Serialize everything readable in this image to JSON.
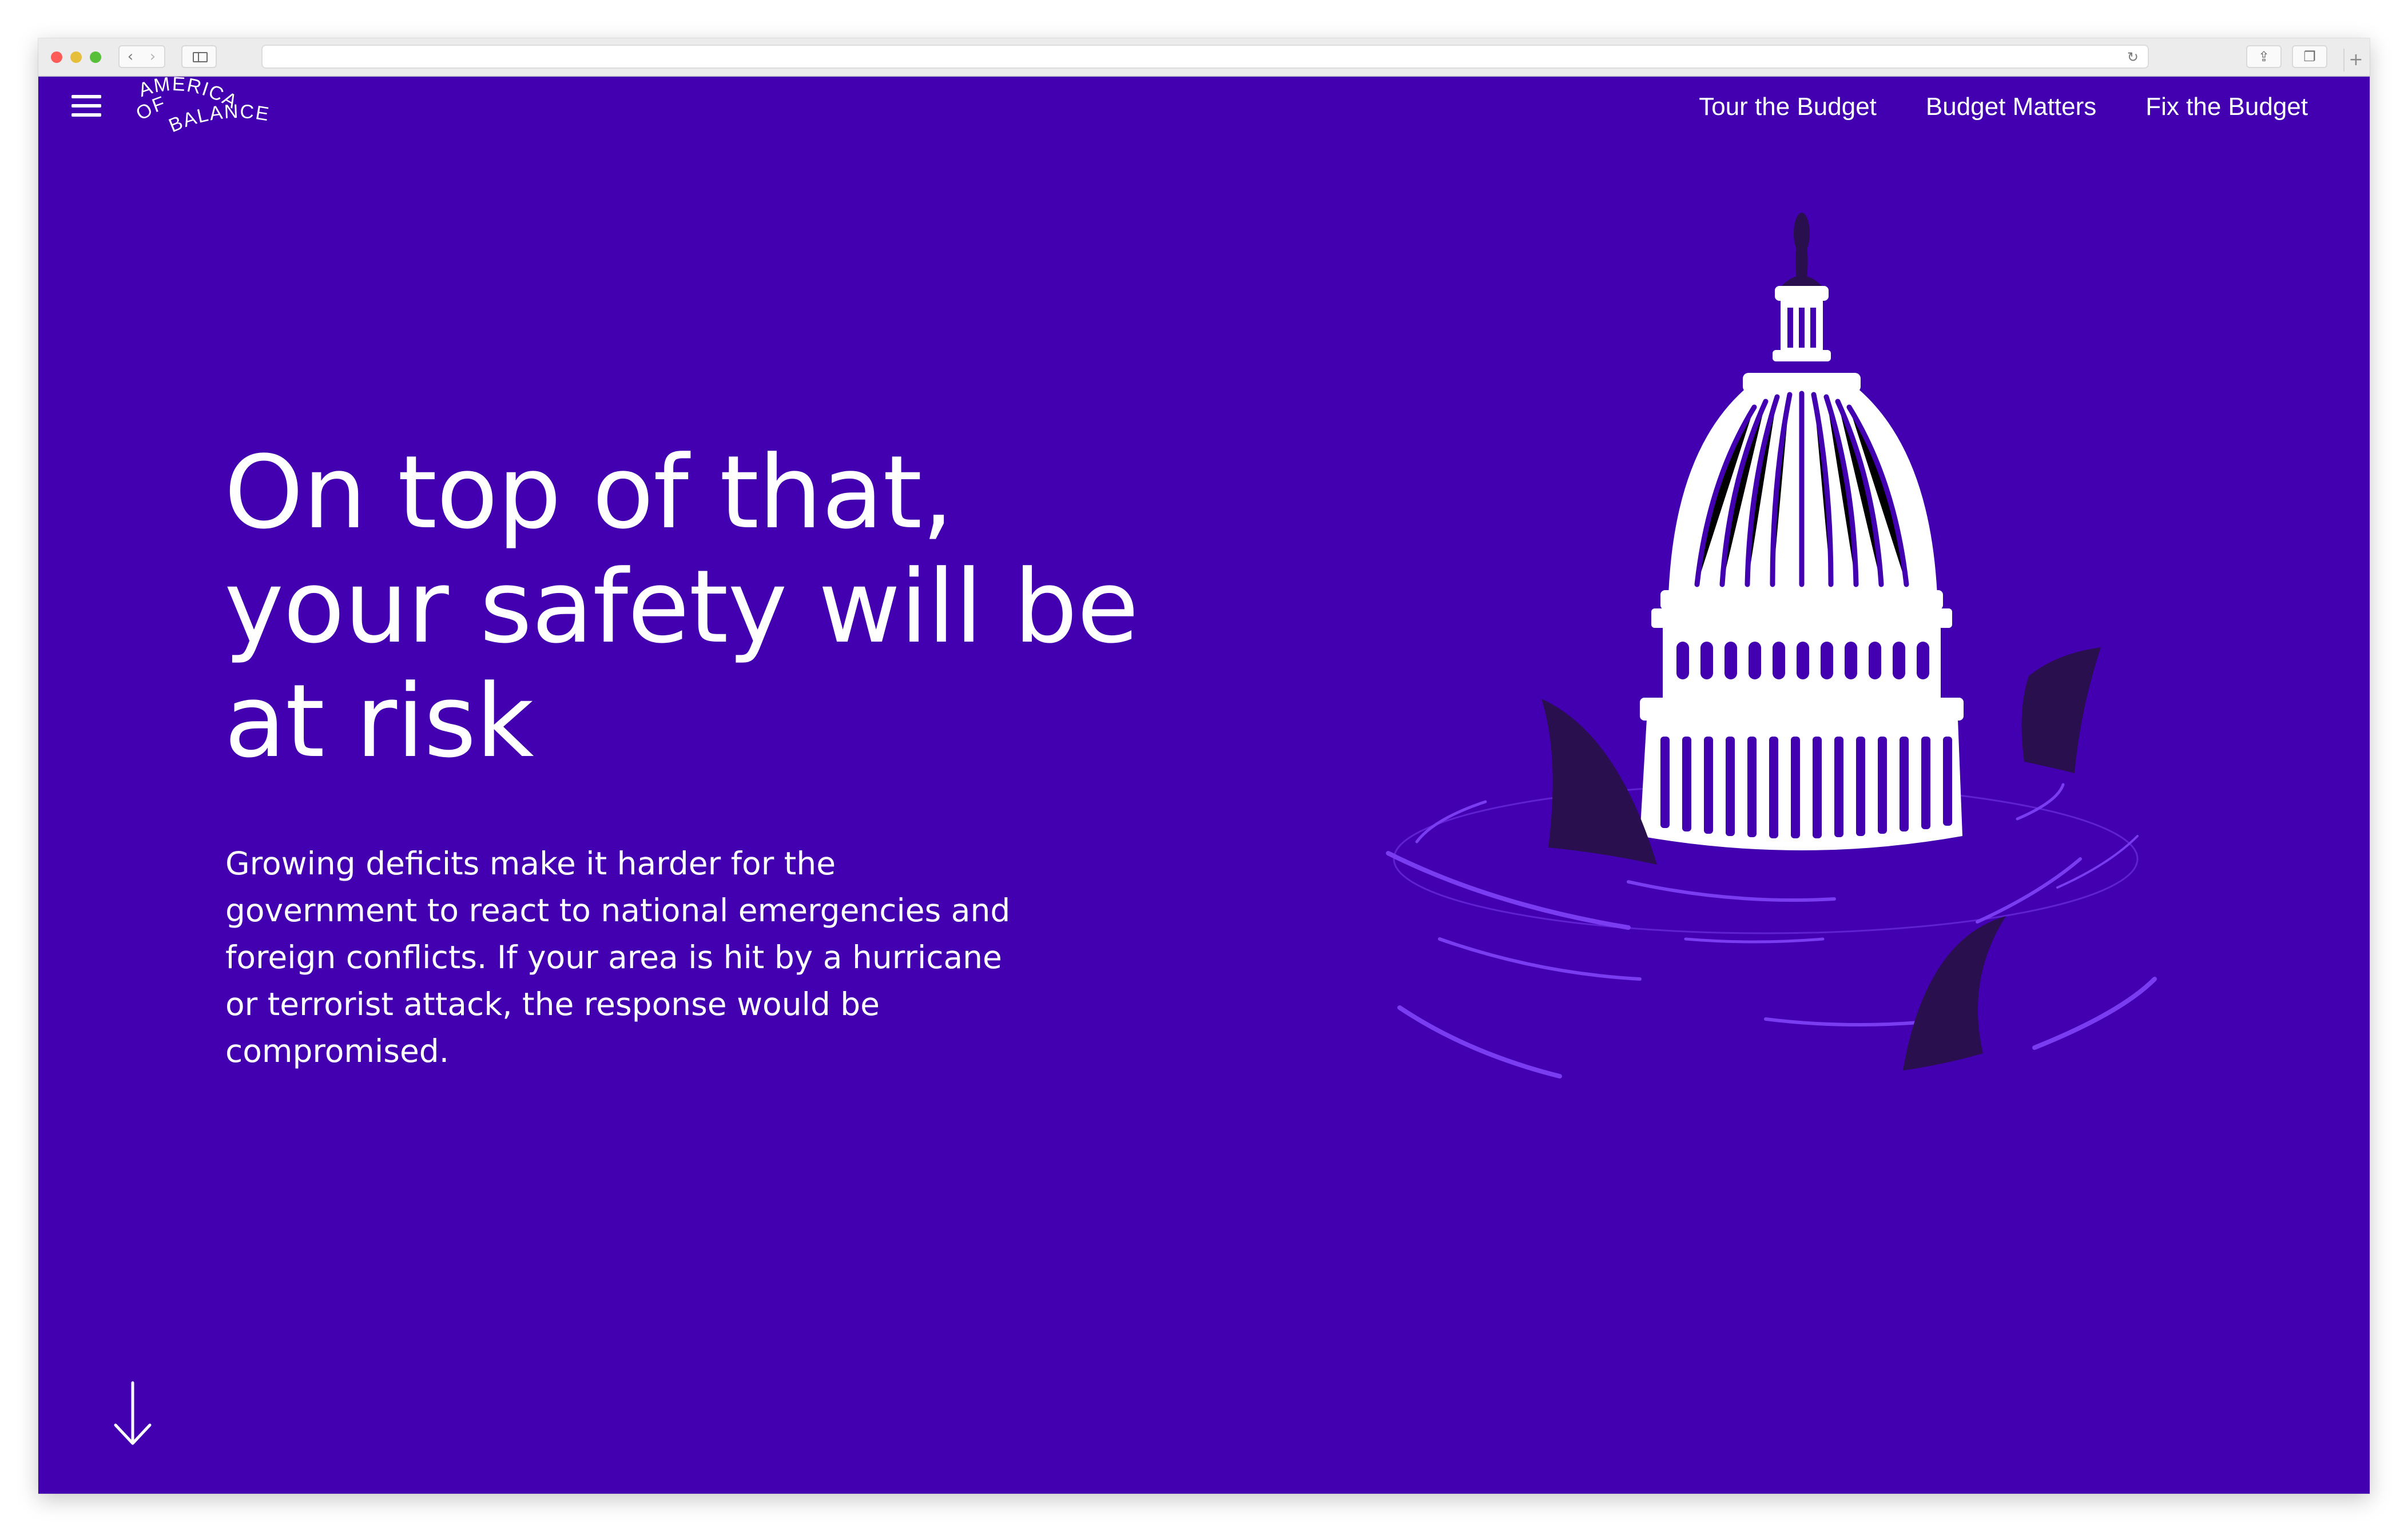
{
  "logo": {
    "line1": "AMERICA",
    "line2_a": "OFF",
    "line2_b": "BALANCE"
  },
  "nav": {
    "links": [
      "Tour the Budget",
      "Budget Matters",
      "Fix the Budget"
    ]
  },
  "hero": {
    "headline_lines": [
      "On top of that,",
      "your safety will be",
      "at risk"
    ],
    "body_lines": [
      "Growing deficits make it harder for the",
      "government to react to national emergencies and",
      "foreign conflicts. If your area is hit by a hurricane",
      "or terrorist attack, the response would be",
      "compromised."
    ]
  },
  "colors": {
    "background": "#4200b0",
    "text": "#ffffff",
    "fin": "#2a0f4f",
    "ripple": "#7a3cf0"
  },
  "icons": {
    "menu": "hamburger-icon",
    "scroll": "arrow-down-icon",
    "illustration": "capitol-dome-with-shark-fins"
  }
}
